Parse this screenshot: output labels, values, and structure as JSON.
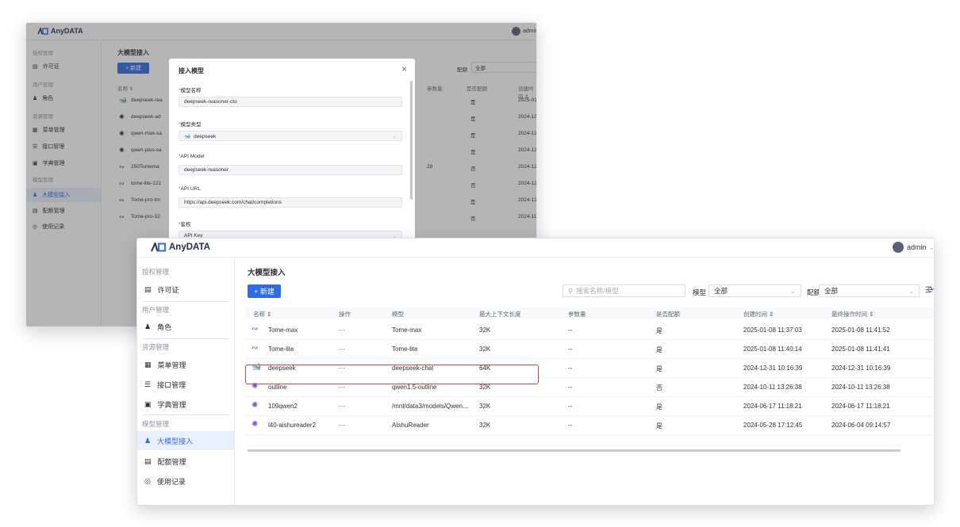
{
  "app": {
    "name": "AnyDATA",
    "user": "admin"
  },
  "sidebar": {
    "groups": [
      {
        "title": "授权管理",
        "items": [
          {
            "label": "许可证",
            "icon": "license-icon"
          }
        ]
      },
      {
        "title": "用户管理",
        "items": [
          {
            "label": "角色",
            "icon": "role-icon"
          }
        ]
      },
      {
        "title": "资源管理",
        "items": [
          {
            "label": "菜单管理",
            "icon": "menu-icon"
          },
          {
            "label": "接口管理",
            "icon": "api-icon"
          },
          {
            "label": "字典管理",
            "icon": "dict-icon"
          }
        ]
      },
      {
        "title": "模型管理",
        "items": [
          {
            "label": "大模型接入",
            "icon": "model-icon",
            "active": true
          },
          {
            "label": "配额管理",
            "icon": "quota-icon"
          },
          {
            "label": "使用记录",
            "icon": "record-icon"
          }
        ]
      }
    ]
  },
  "page": {
    "title": "大模型接入",
    "new_button": "+ 新建",
    "search_placeholder": "搜索名称/模型",
    "filter_model_label": "模型",
    "filter_model_value": "全部",
    "filter_quota_label": "配额",
    "filter_quota_value": "全部"
  },
  "table": {
    "headers": [
      "名称 ⇕",
      "操作",
      "模型",
      "最大上下文长度",
      "参数量",
      "是否配额",
      "创建时间 ⇕",
      "最终操作时间 ⇕"
    ],
    "rows": [
      {
        "icon": "tome-icon",
        "name": "Tome-max",
        "op": "···",
        "model": "Tome-max",
        "ctx": "32K",
        "params": "--",
        "quota": "是",
        "created": "2025-01-08 11:37:03",
        "updated": "2025-01-08 11:41:52"
      },
      {
        "icon": "tome-icon",
        "name": "Tome-lite",
        "op": "···",
        "model": "Tome-lite",
        "ctx": "32K",
        "params": "--",
        "quota": "是",
        "created": "2025-01-08 11:40:14",
        "updated": "2025-01-08 11:41:41"
      },
      {
        "icon": "deepseek-icon",
        "name": "deepseek",
        "op": "···",
        "model": "deepseek-chat",
        "ctx": "64K",
        "params": "--",
        "quota": "是",
        "created": "2024-12-31 10:16:39",
        "updated": "2024-12-31 10:16:39"
      },
      {
        "icon": "qwen-icon",
        "name": "outline",
        "op": "···",
        "model": "qwen1.5-outline",
        "ctx": "32K",
        "params": "--",
        "quota": "否",
        "created": "2024-10-11 13:26:38",
        "updated": "2024-10-11 13:26:38"
      },
      {
        "icon": "qwen-icon",
        "name": "109qwen2",
        "op": "···",
        "model": "/mnt/data3/models/Qwen...",
        "ctx": "32K",
        "params": "--",
        "quota": "是",
        "created": "2024-06-17 11:18:21",
        "updated": "2024-06-17 11:18:21"
      },
      {
        "icon": "qwen-icon",
        "name": "l40-aishureader2",
        "op": "···",
        "model": "AIshuReader",
        "ctx": "32K",
        "params": "--",
        "quota": "是",
        "created": "2024-05-28 17:12:45",
        "updated": "2024-06-04 09:14:57"
      }
    ]
  },
  "back_table": {
    "headers": [
      "名称 ⇕",
      "参数量",
      "是否配额",
      "创建时间 ⇕"
    ],
    "rows": [
      {
        "name": "deepseek-rea",
        "quota": "是",
        "created": "2025-01-22 1",
        "params": ""
      },
      {
        "name": "deepseek-ad",
        "quota": "是",
        "created": "2024-12-31 (",
        "params": ""
      },
      {
        "name": "qwen-max-sa",
        "quota": "是",
        "created": "2024-12-30 1",
        "params": ""
      },
      {
        "name": "qwen-plus-sa",
        "quota": "是",
        "created": "2024-12-30 1",
        "params": ""
      },
      {
        "name": "250Tomema",
        "quota": "否",
        "created": "2024-12-24 (",
        "params": "28"
      },
      {
        "name": "tome-lite-122",
        "quota": "否",
        "created": "2024-12-20 2",
        "params": ""
      },
      {
        "name": "Tome-pro-tm",
        "quota": "是",
        "created": "2024-12-20 2",
        "params": ""
      },
      {
        "name": "Tome-pro-32",
        "quota": "否",
        "created": "2024-11-29 1",
        "params": ""
      }
    ]
  },
  "modal": {
    "title": "接入模型",
    "close": "×",
    "fields": [
      {
        "label": "模型名称",
        "value": "deepseek-reasoner-cto"
      },
      {
        "label": "模型类型",
        "value": "deepseek"
      },
      {
        "label": "API Model",
        "value": "deepseek-reasoner"
      },
      {
        "label": "API URL",
        "value": "https://api.deepseek.com/chat/completions"
      },
      {
        "label": "鉴权",
        "value": "API Key"
      }
    ]
  },
  "colors": {
    "primary": "#2e6be6",
    "highlight": "#c8473e",
    "active_bg": "#e8f0ff"
  }
}
